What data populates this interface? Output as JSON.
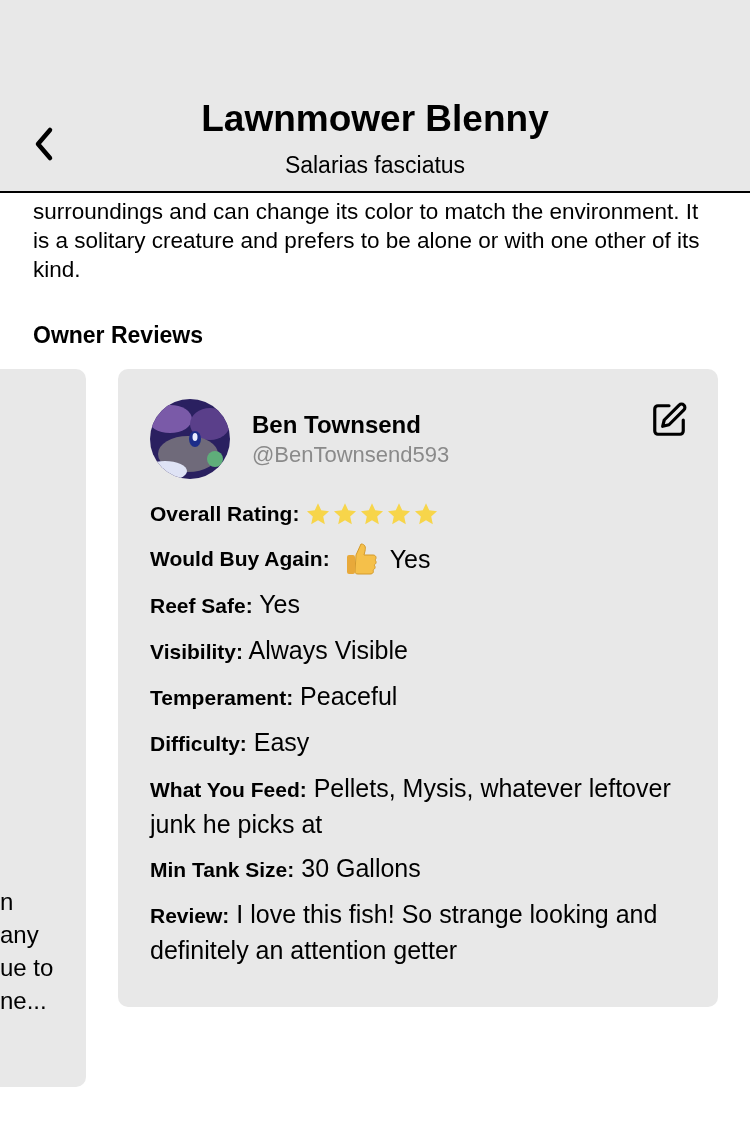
{
  "header": {
    "title": "Lawnmower Blenny",
    "subtitle": "Salarias fasciatus"
  },
  "description": "surroundings and can change its color to match the environment. It is a solitary creature and prefers to be alone or with one other of its kind.",
  "section_title": "Owner Reviews",
  "previous_review": {
    "lines": [
      "n",
      "any",
      "ue to",
      "ne..."
    ]
  },
  "review": {
    "name": "Ben Townsend",
    "handle": "@BenTownsend593",
    "fields": [
      {
        "kind": "stars",
        "label": "Overall Rating:",
        "stars": 5
      },
      {
        "kind": "thumb",
        "label": "Would Buy Again:",
        "value": "Yes"
      },
      {
        "kind": "text",
        "label": "Reef Safe:",
        "value": "Yes"
      },
      {
        "kind": "text",
        "label": "Visibility:",
        "value": "Always Visible"
      },
      {
        "kind": "text",
        "label": "Temperament:",
        "value": "Peaceful"
      },
      {
        "kind": "text",
        "label": "Difficulty:",
        "value": "Easy"
      },
      {
        "kind": "text",
        "label": "What You Feed:",
        "value": "Pellets, Mysis, whatever leftover junk he picks at"
      },
      {
        "kind": "text",
        "label": "Min Tank Size:",
        "value": "30 Gallons"
      },
      {
        "kind": "text",
        "label": "Review:",
        "value": "I love this fish! So strange looking and definitely an attention getter"
      }
    ]
  }
}
